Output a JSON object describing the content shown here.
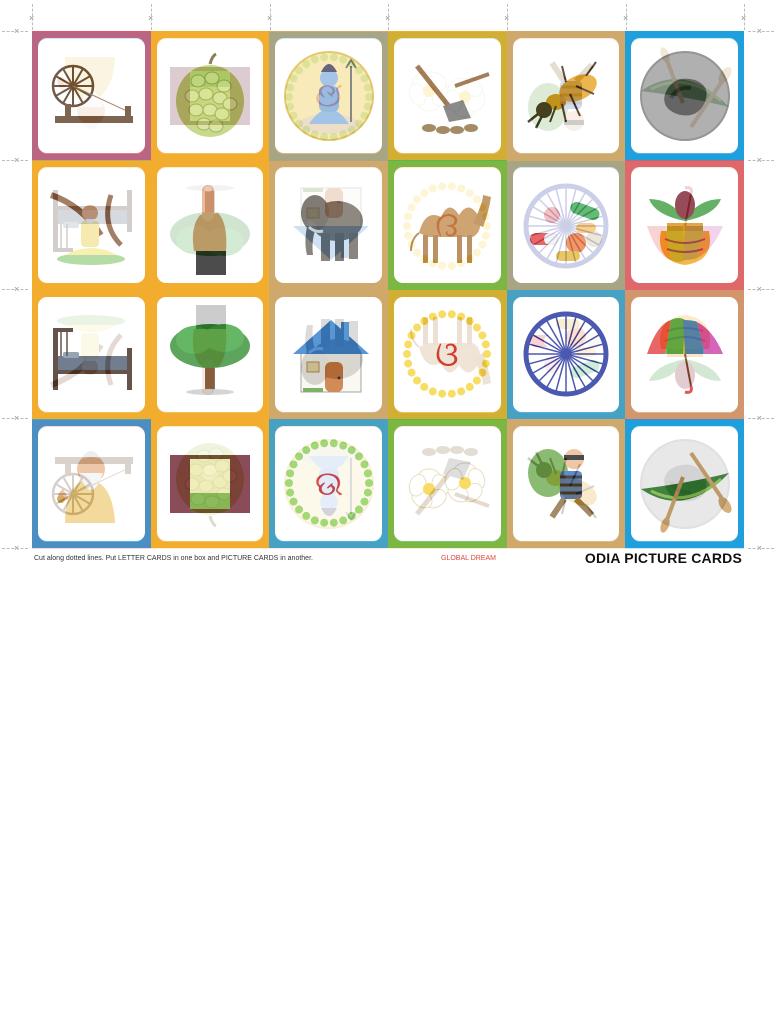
{
  "footer": {
    "instructions": "Cut along dotted lines. Put LETTER CARDS in one box and PICTURE CARDS in another.",
    "brand": "GLOBAL DREAM",
    "title": "ODIA PICTURE CARDS"
  },
  "colors": {
    "pink": "#e4566b",
    "orange": "#f3ad2e",
    "tan": "#cfa86b",
    "blue": "#1f9fdc",
    "green": "#5bb94a"
  },
  "cards": [
    {
      "icon": "spinning-wheel-icon",
      "frame": "#e4566b"
    },
    {
      "icon": "custard-apple-icon",
      "frame": "#f3ad2e"
    },
    {
      "icon": "lord-shiva-icon",
      "frame": "#cfa86b"
    },
    {
      "icon": "plough-icon",
      "frame": "#f3ad2e"
    },
    {
      "icon": "termite-icon",
      "frame": "#cfa86b"
    },
    {
      "icon": "pit-hole-icon",
      "frame": "#1f9fdc"
    },
    {
      "icon": "meditating-sage-icon",
      "frame": "#f3ad2e"
    },
    {
      "icon": "pointing-finger-icon",
      "frame": "#f3ad2e"
    },
    {
      "icon": "elephant-icon",
      "frame": "#cfa86b"
    },
    {
      "icon": "camel-icon",
      "frame": "#5bb94a"
    },
    {
      "icon": "medicine-pills-icon",
      "frame": "#cfa86b"
    },
    {
      "icon": "kalash-pot-icon",
      "frame": "#e4566b"
    },
    {
      "icon": "bed-icon",
      "frame": "#f3ad2e"
    },
    {
      "icon": "tree-icon",
      "frame": "#f3ad2e"
    },
    {
      "icon": "house-icon",
      "frame": "#cfa86b"
    },
    {
      "icon": "odia-letter-o-icon",
      "frame": "#f3ad2e"
    },
    {
      "icon": "ashoka-chakra-icon",
      "frame": "#1f9fdc"
    },
    {
      "icon": "umbrella-icon",
      "frame": "#cfa86b"
    },
    {
      "icon": "rishi-sage-icon",
      "frame": "#1f9fdc"
    },
    {
      "icon": "window-icon",
      "frame": "#f3ad2e"
    },
    {
      "icon": "odia-letter-u-icon",
      "frame": "#1f9fdc"
    },
    {
      "icon": "flowers-icon",
      "frame": "#5bb94a"
    },
    {
      "icon": "thief-icon",
      "frame": "#cfa86b"
    },
    {
      "icon": "boat-icon",
      "frame": "#1f9fdc"
    }
  ]
}
